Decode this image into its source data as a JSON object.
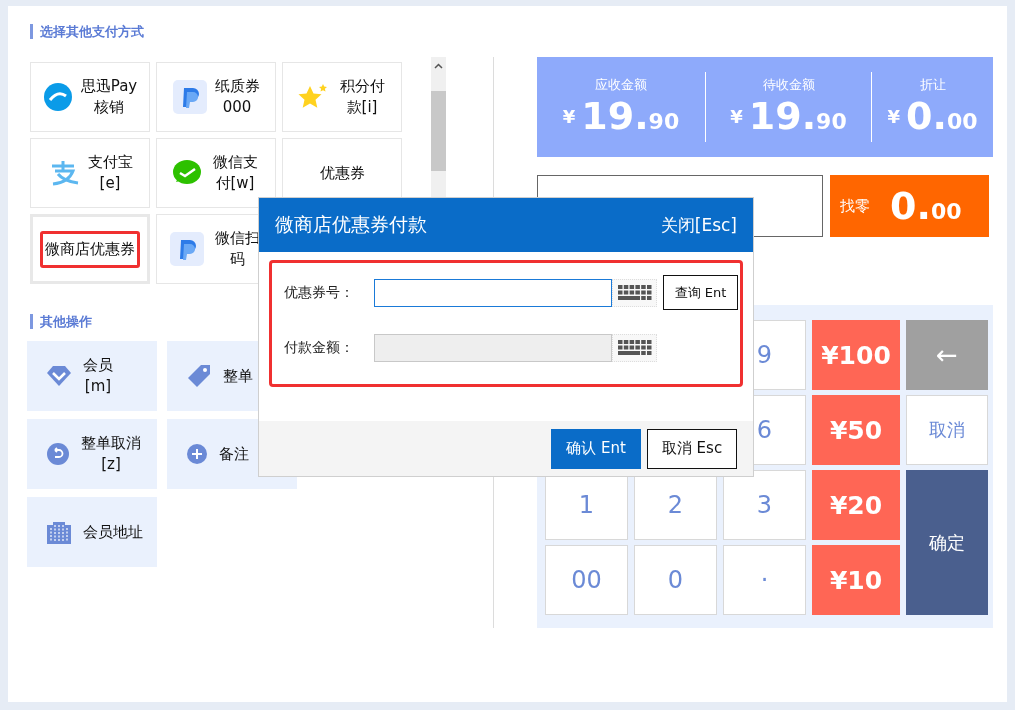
{
  "payment_section": {
    "title": "选择其他支付方式",
    "tiles": [
      {
        "kind": "circle",
        "label": "思迅Pay\n核销",
        "selected": false,
        "highlighted": false
      },
      {
        "kind": "pcard",
        "label": "纸质券\n000",
        "selected": false,
        "highlighted": false
      },
      {
        "kind": "star",
        "label": "积分付款[i]",
        "selected": false,
        "highlighted": false
      },
      {
        "kind": "alipay",
        "label": "支付宝\n[e]",
        "selected": false,
        "highlighted": false
      },
      {
        "kind": "chat",
        "label": "微信支付[w]",
        "selected": false,
        "highlighted": false
      },
      {
        "kind": "plain",
        "label": "优惠券",
        "selected": false,
        "highlighted": false
      },
      {
        "kind": "plain",
        "label": "微商店优惠券",
        "selected": true,
        "highlighted": true
      },
      {
        "kind": "pcard",
        "label": "微信扫码",
        "selected": false,
        "highlighted": false
      }
    ]
  },
  "operations_section": {
    "title": "其他操作",
    "cards": [
      {
        "kind": "diamond",
        "label": "会员\n[m]"
      },
      {
        "kind": "tag",
        "label": "整单"
      },
      {
        "kind": "blank"
      },
      {
        "kind": "undo",
        "label": "整单取消\n[z]"
      },
      {
        "kind": "plus",
        "label": "备注"
      },
      {
        "kind": "blank"
      },
      {
        "kind": "building",
        "label": "会员地址"
      }
    ]
  },
  "summary": [
    {
      "label": "应收金额",
      "currency": "¥",
      "amount": "19.90"
    },
    {
      "label": "待收金额",
      "currency": "¥",
      "amount": "19.90"
    },
    {
      "label": "折让",
      "currency": "¥",
      "amount": "0.00"
    }
  ],
  "change": {
    "label": "找零",
    "amount": "0.00"
  },
  "keypad": {
    "digit_rows": [
      [
        "9"
      ],
      [
        "6"
      ],
      [
        "1",
        "2",
        "3"
      ],
      [
        "00",
        "0",
        "·"
      ]
    ],
    "quick_amounts": [
      "¥100",
      "¥50",
      "¥20",
      "¥10"
    ],
    "actions": [
      {
        "kind": "backspace",
        "label": "←"
      },
      {
        "kind": "cancel",
        "label": "取消"
      },
      {
        "kind": "confirm",
        "label": "确定"
      }
    ]
  },
  "dialog": {
    "title": "微商店优惠券付款",
    "close": "关闭[Esc]",
    "highlighted": true,
    "fields": [
      {
        "label": "优惠券号：",
        "disabled": false,
        "button": "查询 Ent"
      },
      {
        "label": "付款金额：",
        "disabled": true
      }
    ],
    "buttons": [
      {
        "kind": "primary",
        "label": "确认 Ent"
      },
      {
        "kind": "secondary",
        "label": "取消 Esc"
      }
    ]
  }
}
